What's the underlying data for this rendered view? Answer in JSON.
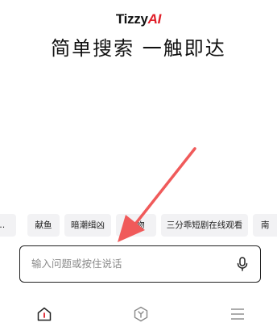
{
  "header": {
    "logo_text": "Tizzy",
    "logo_accent": "AI",
    "slogan": "简单搜索 一触即达"
  },
  "suggestions": [
    {
      "label": "…"
    },
    {
      "label": "献鱼"
    },
    {
      "label": "暗潮缉凶"
    },
    {
      "label": "…物"
    },
    {
      "label": "三分乖短剧在线观看"
    },
    {
      "label": "南"
    }
  ],
  "search": {
    "placeholder": "输入问题或按住说话",
    "value": ""
  },
  "icons": {
    "mic": "microphone-icon",
    "home": "home-icon",
    "discover": "discover-icon",
    "menu": "menu-icon"
  },
  "colors": {
    "brand_accent": "#e0202a",
    "annotation_arrow": "#f05a5a",
    "chip_bg": "#f2f2f4",
    "border": "#222222"
  }
}
